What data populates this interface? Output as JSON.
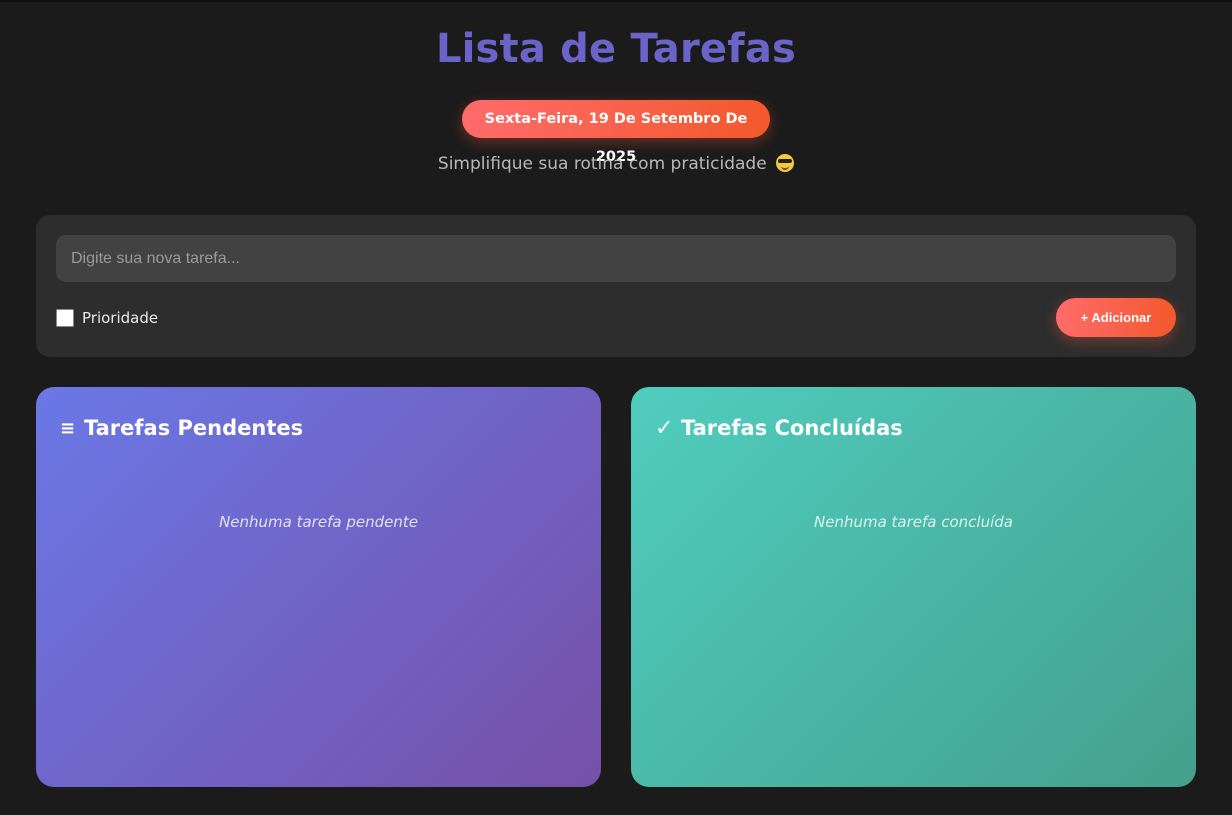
{
  "header": {
    "title": "Lista de Tarefas",
    "date": "Sexta-Feira, 19 De Setembro De 2025",
    "subtitle": "Simplifique sua rotina com praticidade",
    "subtitle_icon": "sunglasses-emoji-icon"
  },
  "form": {
    "input_placeholder": "Digite sua nova tarefa...",
    "input_value": "",
    "priority_label": "Prioridade",
    "priority_checked": false,
    "add_button_label": "+ Adicionar"
  },
  "panels": {
    "pending": {
      "icon": "≡",
      "icon_name": "list-icon",
      "title": "Tarefas Pendentes",
      "empty_message": "Nenhuma tarefa pendente"
    },
    "done": {
      "icon": "✓",
      "icon_name": "check-icon",
      "title": "Tarefas Concluídas",
      "empty_message": "Nenhuma tarefa concluída"
    }
  },
  "colors": {
    "background": "#1b1b1b",
    "title": "#6a63c8",
    "accent_gradient_start": "#ff6b6b",
    "accent_gradient_end": "#f2592c",
    "pending_gradient_start": "#6a78e6",
    "pending_gradient_end": "#7650a8",
    "done_gradient_start": "#50cdbf",
    "done_gradient_end": "#44a08d"
  }
}
